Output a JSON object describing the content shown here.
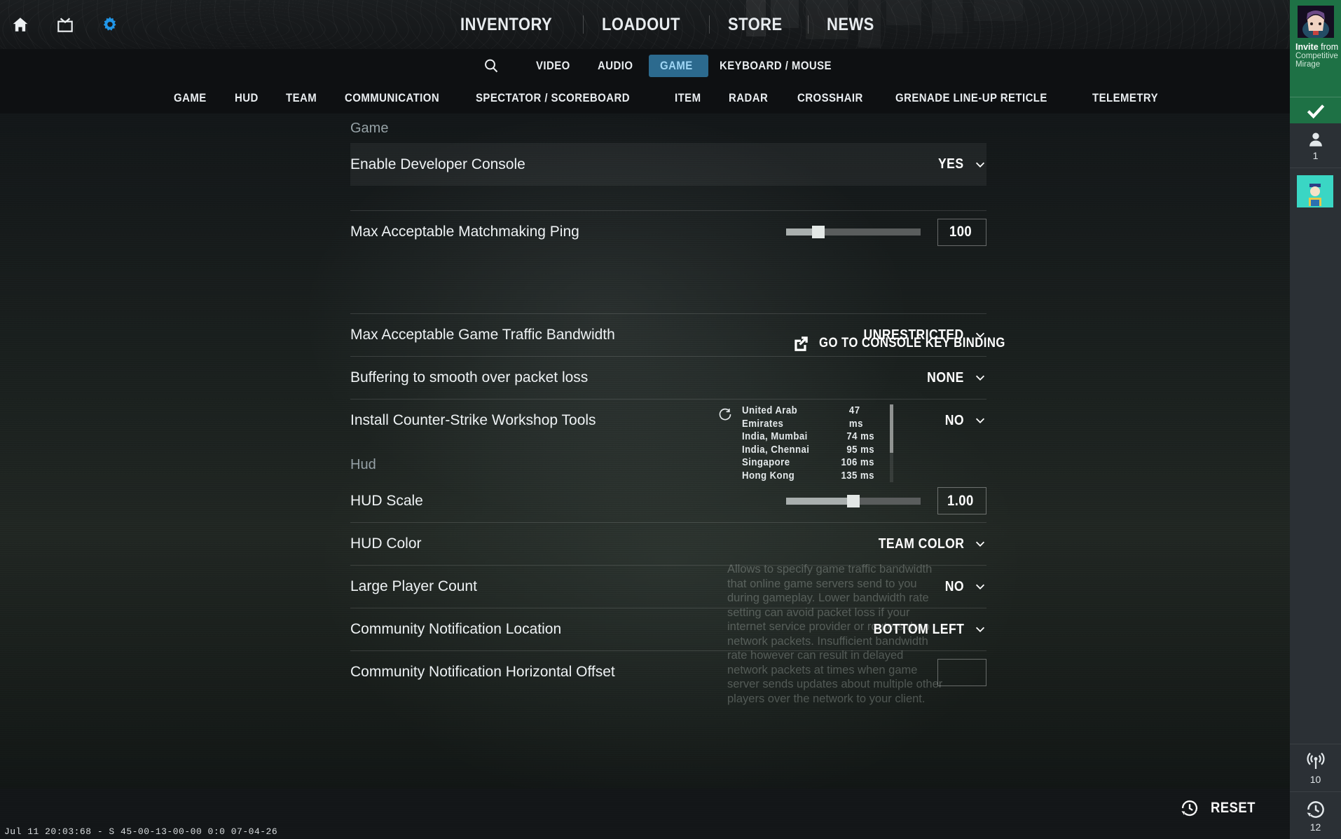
{
  "topbar": {
    "icons": [
      {
        "name": "home-icon",
        "label": "Home"
      },
      {
        "name": "tv-icon",
        "label": "Watch"
      },
      {
        "name": "gear-icon",
        "label": "Settings"
      }
    ],
    "nav": [
      {
        "label": "INVENTORY"
      },
      {
        "label": "LOADOUT"
      },
      {
        "label": "STORE"
      },
      {
        "label": "NEWS"
      }
    ]
  },
  "categories": {
    "search_icon": "search-icon",
    "items": [
      {
        "label": "VIDEO",
        "active": false
      },
      {
        "label": "AUDIO",
        "active": false
      },
      {
        "label": "GAME",
        "active": true
      },
      {
        "label": "KEYBOARD / MOUSE",
        "active": false
      }
    ],
    "active_color": "#2c6a8e",
    "active_text_color": "#9fd6f5"
  },
  "subtabs": [
    {
      "label": "GAME"
    },
    {
      "label": "HUD"
    },
    {
      "label": "TEAM"
    },
    {
      "label": "COMMUNICATION"
    },
    {
      "label": "SPECTATOR / SCOREBOARD"
    },
    {
      "label": "ITEM"
    },
    {
      "label": "RADAR"
    },
    {
      "label": "CROSSHAIR"
    },
    {
      "label": "GRENADE LINE-UP RETICLE"
    },
    {
      "label": "TELEMETRY"
    }
  ],
  "sections": {
    "game_title": "Game",
    "hud_title": "Hud"
  },
  "settings": {
    "developer_console": {
      "label": "Enable Developer Console",
      "value": "YES"
    },
    "console_key_binding": {
      "label": "GO TO CONSOLE KEY BINDING",
      "icon": "external-link-icon"
    },
    "max_ping": {
      "label": "Max Acceptable Matchmaking Ping",
      "value": "100",
      "slider_percent": 24
    },
    "bandwidth": {
      "label": "Max Acceptable Game Traffic Bandwidth",
      "value": "UNRESTRICTED"
    },
    "buffering": {
      "label": "Buffering to smooth over packet loss",
      "value": "NONE"
    },
    "workshop_tools": {
      "label": "Install Counter-Strike Workshop Tools",
      "value": "NO"
    },
    "hud_scale": {
      "label": "HUD Scale",
      "value": "1.00",
      "slider_percent": 50
    },
    "hud_color": {
      "label": "HUD Color",
      "value": "TEAM COLOR"
    },
    "large_player_count": {
      "label": "Large Player Count",
      "value": "NO"
    },
    "community_notification_location": {
      "label": "Community Notification Location",
      "value": "BOTTOM LEFT"
    },
    "community_notification_offset": {
      "label": "Community Notification Horizontal Offset",
      "value": ""
    }
  },
  "ping_servers": {
    "refresh_icon": "refresh-icon",
    "rows": [
      {
        "name": "United Arab Emirates",
        "ping": "47 ms"
      },
      {
        "name": "India, Mumbai",
        "ping": "74 ms"
      },
      {
        "name": "India, Chennai",
        "ping": "95 ms"
      },
      {
        "name": "Singapore",
        "ping": "106 ms"
      },
      {
        "name": "Hong Kong",
        "ping": "135 ms"
      }
    ]
  },
  "tooltip": {
    "text": "Allows to specify game traffic bandwidth that online game servers send to you during gameplay. Lower bandwidth rate setting can avoid packet loss if your internet service provider or routers drop network packets. Insufficient bandwidth rate however can result in delayed network packets at times when game server sends updates about multiple other players over the network to your client."
  },
  "rail": {
    "invite": {
      "title_bold": "Invite",
      "title_rest": " from",
      "line2": "Competitive",
      "line3": "Mirage",
      "accept_icon": "check-icon",
      "background": "#1e7145"
    },
    "friends": {
      "icon": "person-icon",
      "count": "1"
    },
    "watch": {
      "icon": "broadcast-icon",
      "count": "10"
    },
    "recent": {
      "icon": "history-icon",
      "count": "12"
    }
  },
  "bottom": {
    "reset": {
      "label": "RESET",
      "icon": "history-icon"
    },
    "status": "Jul 11 20:03:68 - S 45-00-13-00-00 0:0 07-04-26"
  }
}
